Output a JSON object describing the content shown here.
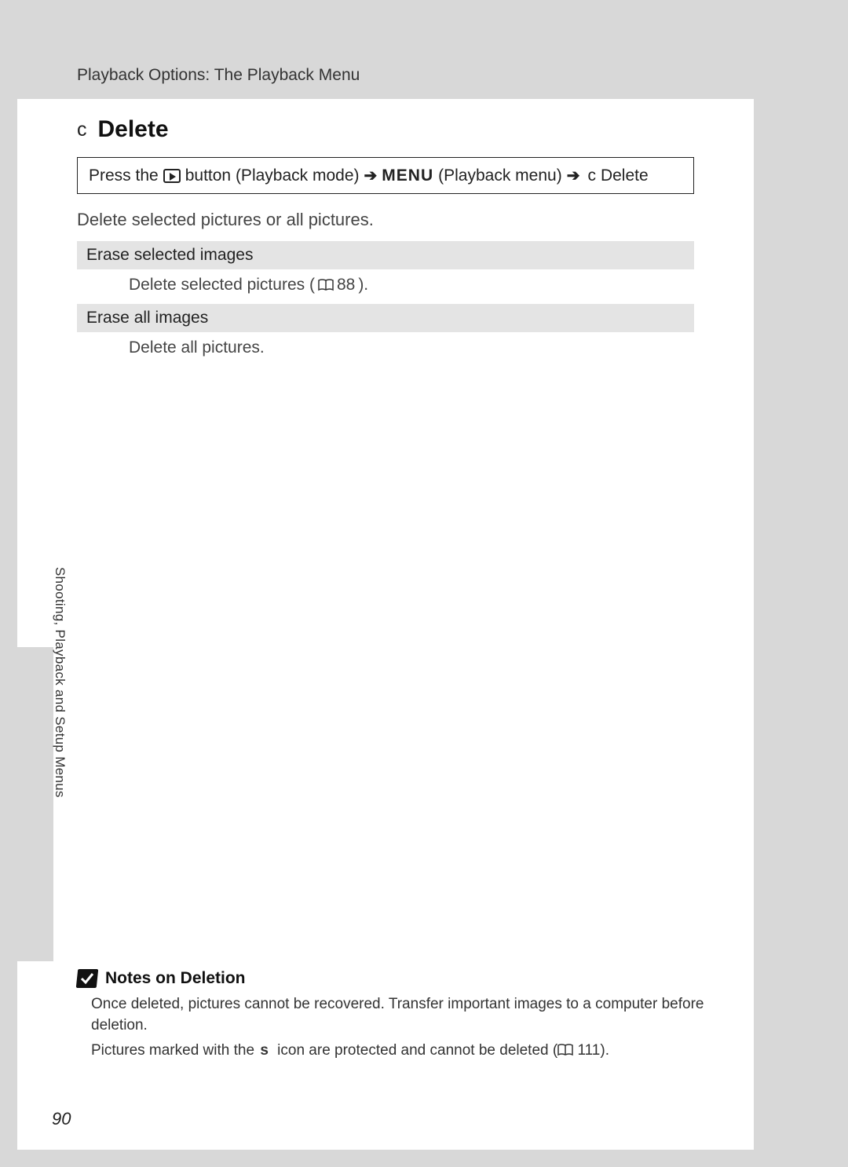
{
  "header": {
    "section_path": "Playback Options: The Playback Menu"
  },
  "title": {
    "icon_char": "c",
    "text": "Delete"
  },
  "nav": {
    "press_the": "Press the",
    "playback_mode": " button (Playback mode) ",
    "arrow": "➔",
    "menu_glyph": "MENU",
    "playback_menu": " (Playback menu) ",
    "delete_icon": "c",
    "delete_label": " Delete"
  },
  "intro": "Delete selected pictures or all pictures.",
  "options": [
    {
      "head": "Erase selected images",
      "desc_pre": "Delete selected pictures (",
      "desc_ref": "88",
      "desc_post": ")."
    },
    {
      "head": "Erase all images",
      "desc_pre": "Delete all pictures.",
      "desc_ref": "",
      "desc_post": ""
    }
  ],
  "side_label": "Shooting, Playback and Setup Menus",
  "notes": {
    "title": "Notes on Deletion",
    "line1": "Once deleted, pictures cannot be recovered. Transfer important images to a computer before deletion.",
    "line2_pre": "Pictures marked with the ",
    "line2_icon": "s",
    "line2_mid": " icon are protected and cannot be deleted (",
    "line2_ref": "111",
    "line2_post": ")."
  },
  "page_number": "90"
}
